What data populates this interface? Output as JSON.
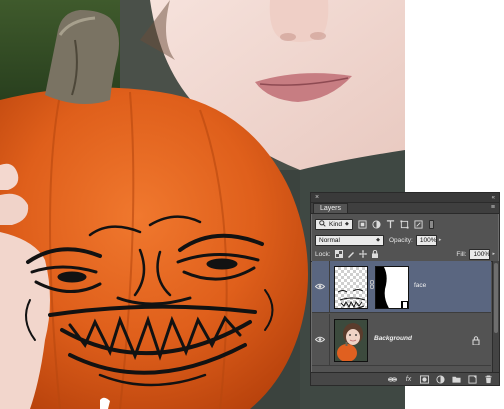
{
  "panel": {
    "close_glyph": "×",
    "collapse_glyph": "«",
    "title": "Layers",
    "menu_glyph": "≡"
  },
  "filter": {
    "kind_label": "Kind",
    "icons": [
      "pixel-filter-icon",
      "adjustment-filter-icon",
      "type-filter-icon",
      "shape-filter-icon",
      "smart-object-filter-icon"
    ]
  },
  "blending": {
    "mode": "Normal",
    "opacity_label": "Opacity:",
    "opacity_value": "100%"
  },
  "locks": {
    "label": "Lock:",
    "fill_label": "Fill:",
    "fill_value": "100%"
  },
  "layers": [
    {
      "name": "face",
      "selected": true,
      "visible": true,
      "has_mask": true
    },
    {
      "name": "Background",
      "selected": false,
      "visible": true,
      "locked": true
    }
  ],
  "bottom_bar": {
    "fx_label": "fx",
    "icons": [
      "link-icon",
      "fx-icon",
      "mask-icon",
      "adjustment-icon",
      "folder-icon",
      "new-layer-icon",
      "trash-icon"
    ]
  },
  "colors": {
    "panel_bg": "#535353",
    "selected_row": "#5a6680",
    "pumpkin": "#e0611c"
  }
}
